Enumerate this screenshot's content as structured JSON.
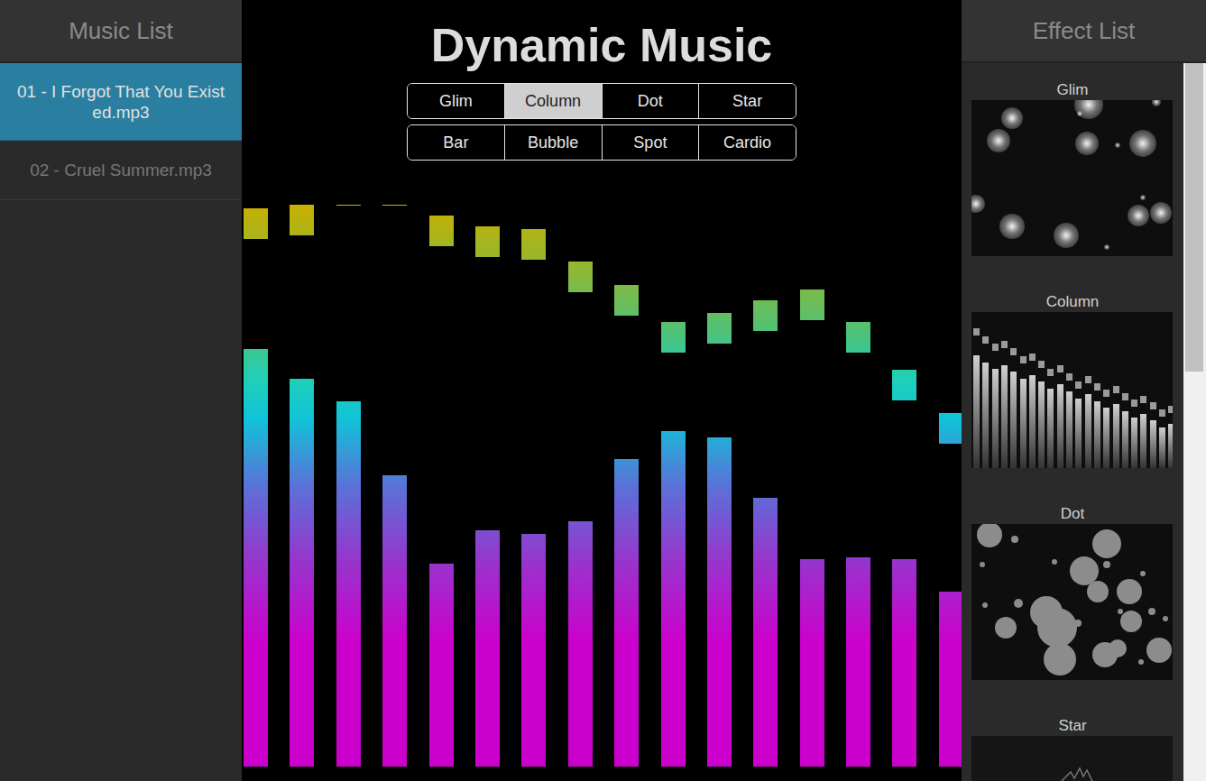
{
  "music_list": {
    "title": "Music List",
    "items": [
      {
        "label": "01 - I Forgot That You Existed.mp3",
        "selected": true
      },
      {
        "label": "02 - Cruel Summer.mp3",
        "selected": false
      }
    ]
  },
  "player": {
    "title": "Dynamic Music",
    "effects": [
      {
        "label": "Glim",
        "selected": false
      },
      {
        "label": "Column",
        "selected": true
      },
      {
        "label": "Dot",
        "selected": false
      },
      {
        "label": "Star",
        "selected": false
      },
      {
        "label": "Bar",
        "selected": false
      },
      {
        "label": "Bubble",
        "selected": false
      },
      {
        "label": "Spot",
        "selected": false
      },
      {
        "label": "Cardio",
        "selected": false
      }
    ]
  },
  "chart": {
    "bars": [
      463,
      430,
      405,
      323,
      225,
      262,
      258,
      272,
      341,
      372,
      365,
      298,
      230,
      232,
      230,
      194
    ],
    "caps": [
      585,
      589,
      622,
      622,
      577,
      565,
      562,
      526,
      500,
      459,
      469,
      483,
      495,
      459,
      406,
      358
    ]
  },
  "effect_list": {
    "title": "Effect List",
    "items": [
      {
        "label": "Glim",
        "kind": "glim"
      },
      {
        "label": "Column",
        "kind": "column"
      },
      {
        "label": "Dot",
        "kind": "dot"
      },
      {
        "label": "Star",
        "kind": "star"
      }
    ],
    "scrollbar": {
      "level": 0.43
    }
  }
}
